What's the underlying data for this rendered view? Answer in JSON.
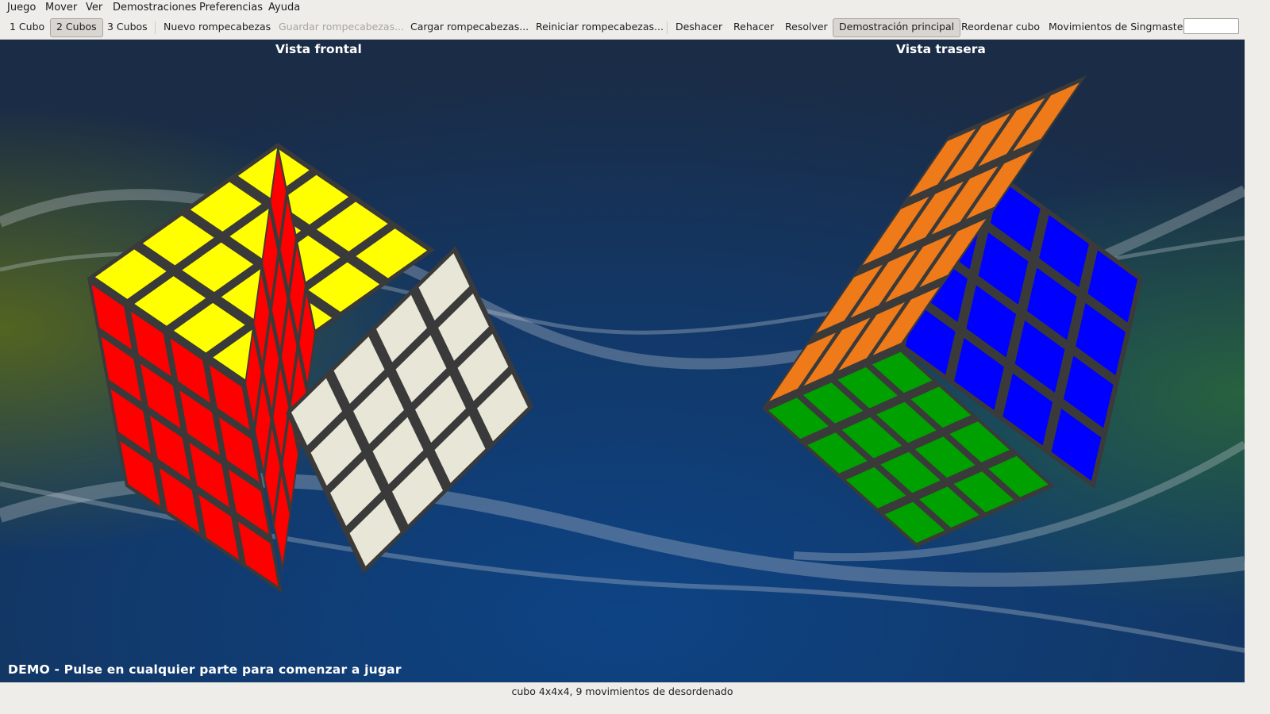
{
  "menu": [
    {
      "label": "Juego"
    },
    {
      "label": "Mover"
    },
    {
      "label": "Ver"
    },
    {
      "label": "Demostraciones"
    },
    {
      "label": "Preferencias"
    },
    {
      "label": "Ayuda"
    }
  ],
  "toolbar": {
    "one_cube": "1 Cubo",
    "two_cubes": "2 Cubos",
    "three_cubes": "3 Cubos",
    "new_puzzle": "Nuevo rompecabezas",
    "save_puzzle": "Guardar rompecabezas...",
    "load_puzzle": "Cargar rompecabezas...",
    "restart_puzzle": "Reiniciar rompecabezas...",
    "undo": "Deshacer",
    "redo": "Rehacer",
    "solve": "Resolver",
    "main_demo": "Demostración principal",
    "reorder_cube": "Reordenar cubo",
    "singmaster_label": "Movimientos de Singmaster",
    "singmaster_value": ""
  },
  "scene": {
    "front_view_label": "Vista frontal",
    "back_view_label": "Vista trasera",
    "demo_text": "DEMO - Pulse en cualquier parte para comenzar a jugar",
    "colors": {
      "yellow": "#ffff00",
      "red": "#ff0000",
      "white": "#e8e6d6",
      "green": "#00a000",
      "orange": "#ee7a1a",
      "blue": "#0000ff",
      "bg_dark": "#142848",
      "bg_blue": "#0e3d78"
    }
  },
  "status": {
    "text": "cubo 4x4x4, 9 movimientos de desordenado"
  }
}
